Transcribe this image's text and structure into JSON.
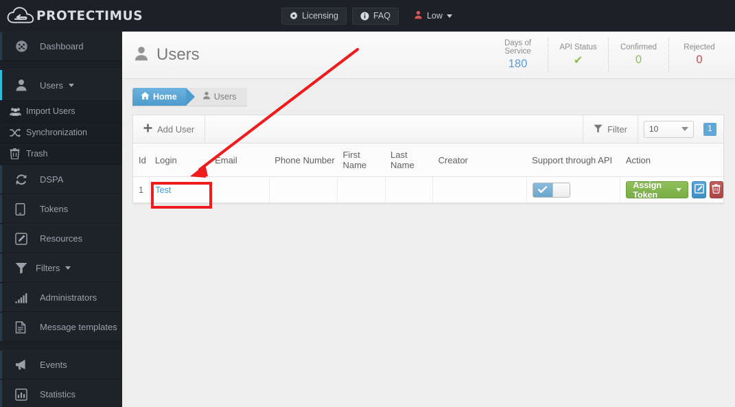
{
  "brand": {
    "name": "PROTECTIMUS",
    "logo_icon": "cloud-arrow-logo"
  },
  "topbar": {
    "licensing_label": "Licensing",
    "licensing_icon": "gear-icon",
    "faq_label": "FAQ",
    "faq_icon": "info-icon",
    "user_label": "Low",
    "user_icon": "user-icon",
    "user_caret_icon": "chevron-down-icon"
  },
  "sidebar": {
    "items": [
      {
        "label": "Dashboard",
        "icon": "dashboard-gauge-icon",
        "accent": "dark",
        "type": "item"
      },
      {
        "label": "Users",
        "icon": "user-icon",
        "accent": "cyan",
        "type": "parent",
        "caret_icon": "chevron-down-icon"
      },
      {
        "label": "Import Users",
        "icon": "users-group-icon",
        "type": "sub"
      },
      {
        "label": "Synchronization",
        "icon": "shuffle-icon",
        "type": "sub"
      },
      {
        "label": "Trash",
        "icon": "trash-icon",
        "type": "sub"
      },
      {
        "label": "DSPA",
        "icon": "refresh-icon",
        "accent": "dark",
        "type": "item"
      },
      {
        "label": "Tokens",
        "icon": "tablet-icon",
        "accent": "dark",
        "type": "item"
      },
      {
        "label": "Resources",
        "icon": "edit-square-icon",
        "accent": "dark",
        "type": "item"
      },
      {
        "label": "Filters",
        "icon": "funnel-icon",
        "accent": "dark",
        "type": "item",
        "caret_icon": "chevron-down-icon"
      },
      {
        "label": "Administrators",
        "icon": "signal-bars-icon",
        "accent": "dark",
        "type": "item"
      },
      {
        "label": "Message templates",
        "icon": "document-icon",
        "accent": "dark",
        "type": "item"
      },
      {
        "label": "Events",
        "icon": "megaphone-icon",
        "accent": "dark",
        "type": "item"
      },
      {
        "label": "Statistics",
        "icon": "bar-chart-icon",
        "accent": "dark",
        "type": "item"
      }
    ]
  },
  "page": {
    "title": "Users",
    "title_icon": "user-icon",
    "stats": [
      {
        "key": "Days of Service",
        "value": "180",
        "color_class": "blue"
      },
      {
        "key": "API Status",
        "value": "✔",
        "color_class": "green"
      },
      {
        "key": "Confirmed",
        "value": "0",
        "color_class": "green"
      },
      {
        "key": "Rejected",
        "value": "0",
        "color_class": "red"
      }
    ]
  },
  "breadcrumb": {
    "home_label": "Home",
    "home_icon": "home-icon",
    "current_label": "Users",
    "current_icon": "user-icon"
  },
  "toolbar": {
    "add_user_label": "Add User",
    "add_user_icon": "plus-icon",
    "filter_label": "Filter",
    "filter_icon": "funnel-icon",
    "page_size_value": "10",
    "page_size_caret_icon": "chevron-down-icon",
    "page_number": "1"
  },
  "table": {
    "columns": [
      "Id",
      "Login",
      "Email",
      "Phone Number",
      "First Name",
      "Last Name",
      "Creator",
      "Support through API",
      "Action"
    ],
    "rows": [
      {
        "id": "1",
        "login": "Test",
        "email": "",
        "phone_number": "",
        "first_name": "",
        "last_name": "",
        "creator": "",
        "support_through_api": "on",
        "action": {
          "assign_token_label": "Assign Token",
          "assign_token_caret_icon": "chevron-down-icon",
          "edit_icon": "edit-pencil-icon",
          "delete_icon": "trash-icon"
        }
      }
    ]
  },
  "colors": {
    "accent_cyan": "#2bbfd9",
    "link_blue": "#3a9ad9",
    "brand_dark": "#1d2127",
    "sidebar_bg": "#1b2026",
    "success_green": "#8cc152",
    "danger_red": "#cc4b4b",
    "annotation_red": "#ee1c1c"
  },
  "annotations": {
    "arrow_icon": "red-arrow-annotation",
    "highlight_icon": "red-box-annotation"
  }
}
